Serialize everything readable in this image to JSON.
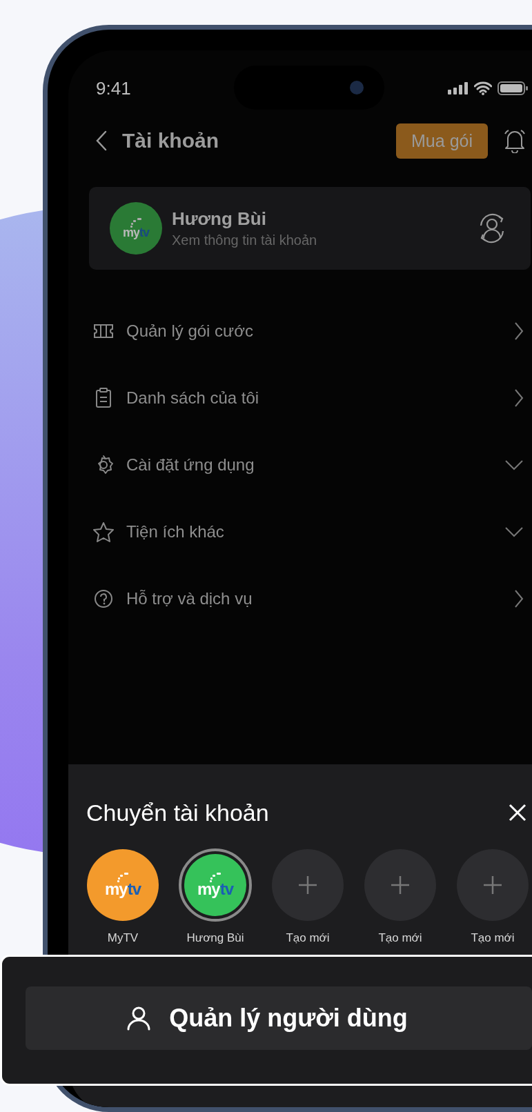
{
  "status_bar": {
    "time": "9:41"
  },
  "header": {
    "title": "Tài khoản",
    "buy_button": "Mua gói"
  },
  "profile": {
    "name": "Hương Bùi",
    "subtitle": "Xem thông tin tài khoản",
    "logo": {
      "main": "my",
      "accent": "tv"
    }
  },
  "menu": [
    {
      "label": "Quản lý gói cước",
      "kind": "link"
    },
    {
      "label": "Danh sách của tôi",
      "kind": "link"
    },
    {
      "label": "Cài đặt ứng dụng",
      "kind": "dropdown"
    },
    {
      "label": "Tiện ích khác",
      "kind": "dropdown"
    },
    {
      "label": "Hỗ trợ và dịch vụ",
      "kind": "link"
    }
  ],
  "switch_sheet": {
    "title": "Chuyển tài khoản",
    "accounts": [
      {
        "kind": "account",
        "label": "MyTV",
        "color": "#f39a2c",
        "selected": false,
        "logo": {
          "main": "my",
          "accent": "tv"
        }
      },
      {
        "kind": "account",
        "label": "Hương Bùi",
        "color": "#35c25a",
        "selected": true,
        "logo": {
          "main": "my",
          "accent": "tv"
        }
      },
      {
        "kind": "add",
        "label": "Tạo mới",
        "selected": false
      },
      {
        "kind": "add",
        "label": "Tạo mới",
        "selected": false
      },
      {
        "kind": "add",
        "label": "Tạo mới",
        "selected": false
      }
    ]
  },
  "manage_button": "Quản lý người dùng"
}
